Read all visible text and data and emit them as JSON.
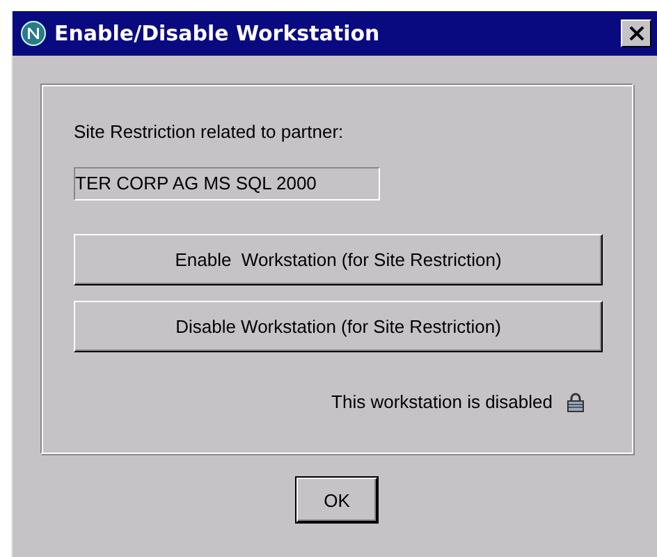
{
  "window": {
    "title": "Enable/Disable Workstation"
  },
  "group": {
    "label": "Site Restriction related to partner:",
    "field": {
      "value": "TER CORP AG MS SQL 2000"
    },
    "buttons": [
      "Enable  Workstation (for Site Restriction)",
      "Disable Workstation (for Site Restriction)"
    ],
    "status": {
      "text": "This workstation is disabled",
      "locked": true
    }
  },
  "footer": {
    "button": "OK"
  }
}
